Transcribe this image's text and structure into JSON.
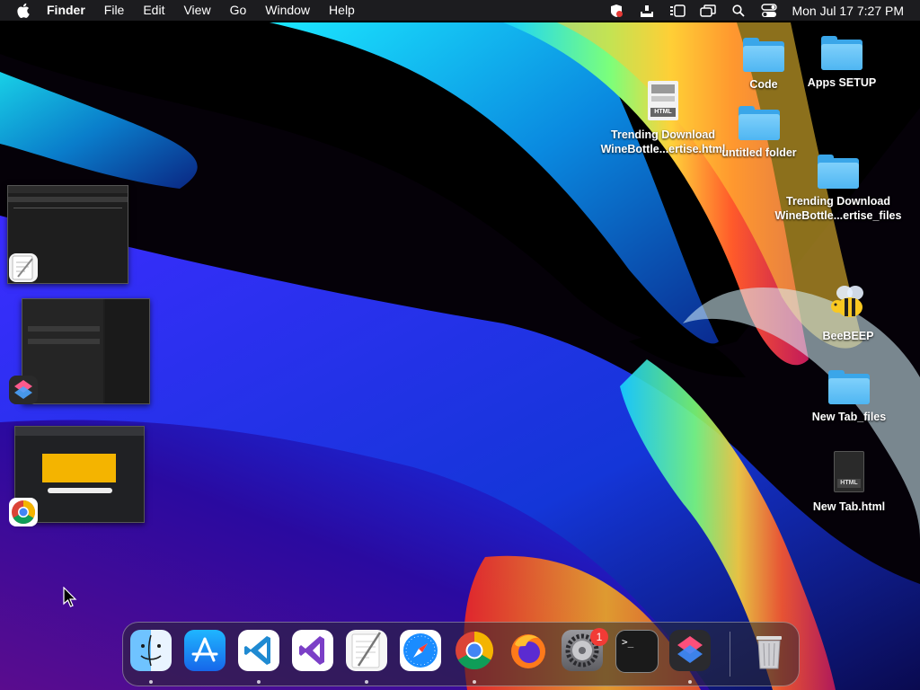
{
  "menubar": {
    "app_name": "Finder",
    "menus": [
      "File",
      "Edit",
      "View",
      "Go",
      "Window",
      "Help"
    ],
    "clock": "Mon Jul 17  7:27 PM",
    "status_icons": [
      "anydesk-icon",
      "airdrop-upload-icon",
      "stage-manager-icon",
      "screen-mirroring-icon",
      "search-icon",
      "control-center-icon"
    ]
  },
  "desktop": {
    "icons": [
      {
        "label": "Code",
        "type": "folder"
      },
      {
        "label": "Apps SETUP",
        "type": "folder"
      },
      {
        "label_line1": "Trending Download",
        "label_line2": "WineBottle...ertise.html",
        "type": "html-file"
      },
      {
        "label": "untitled folder",
        "type": "folder"
      },
      {
        "label_line1": "Trending Download",
        "label_line2": "WineBottle...ertise_files",
        "type": "folder"
      },
      {
        "label": "BeeBEEP",
        "type": "app"
      },
      {
        "label": "New Tab_files",
        "type": "folder"
      },
      {
        "label": "New Tab.html",
        "type": "html-file"
      }
    ],
    "html_file_tag": "HTML"
  },
  "stacks": [
    {
      "app": "TextEdit",
      "icon": "textedit-icon"
    },
    {
      "app": "Shortcuts",
      "icon": "shortcuts-icon"
    },
    {
      "app": "Google Chrome",
      "icon": "chrome-icon"
    }
  ],
  "dock": {
    "apps": [
      {
        "name": "Finder",
        "icon": "finder-icon",
        "running": true
      },
      {
        "name": "App Store",
        "icon": "app-store-icon",
        "running": false
      },
      {
        "name": "Visual Studio Code",
        "icon": "vscode-icon",
        "running": true
      },
      {
        "name": "Visual Studio",
        "icon": "visual-studio-icon",
        "running": false
      },
      {
        "name": "TextEdit",
        "icon": "textedit-icon",
        "running": true
      },
      {
        "name": "Safari",
        "icon": "safari-icon",
        "running": false
      },
      {
        "name": "Google Chrome",
        "icon": "chrome-icon",
        "running": true
      },
      {
        "name": "Firefox",
        "icon": "firefox-icon",
        "running": false
      },
      {
        "name": "System Settings",
        "icon": "settings-icon",
        "running": false,
        "badge": "1"
      },
      {
        "name": "Terminal",
        "icon": "terminal-icon",
        "running": false,
        "glyph": ">_"
      },
      {
        "name": "Shortcuts",
        "icon": "shortcuts-icon",
        "running": true
      },
      {
        "name": "Trash",
        "icon": "trash-icon",
        "running": false
      }
    ]
  },
  "colors": {
    "folder_blue": "#4fb6f2",
    "menubar_bg": "#1e1e22",
    "badge_red": "#f23b36"
  }
}
